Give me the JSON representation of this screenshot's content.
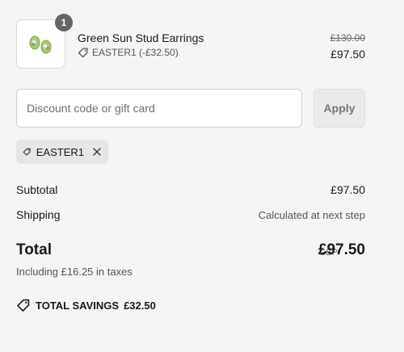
{
  "product": {
    "quantity": "1",
    "name": "Green Sun Stud Earrings",
    "discount_label": "EASTER1 (-£32.50)",
    "price_original": "£130.00",
    "price_final": "£97.50",
    "image_icon": "earring-image"
  },
  "discount": {
    "placeholder": "Discount code or gift card",
    "value": "",
    "apply_label": "Apply",
    "applied_code": "EASTER1"
  },
  "summary": {
    "subtotal_label": "Subtotal",
    "subtotal_value": "£97.50",
    "shipping_label": "Shipping",
    "shipping_value": "Calculated at next step",
    "total_label": "Total",
    "currency": "GBP",
    "total_value": "£97.50",
    "tax_note": "Including £16.25 in taxes",
    "savings_label": "TOTAL SAVINGS",
    "savings_value": "£32.50"
  },
  "colors": {
    "background": "#f5f5f5",
    "badge": "#666666",
    "earring_green": "#9bbf6a"
  }
}
